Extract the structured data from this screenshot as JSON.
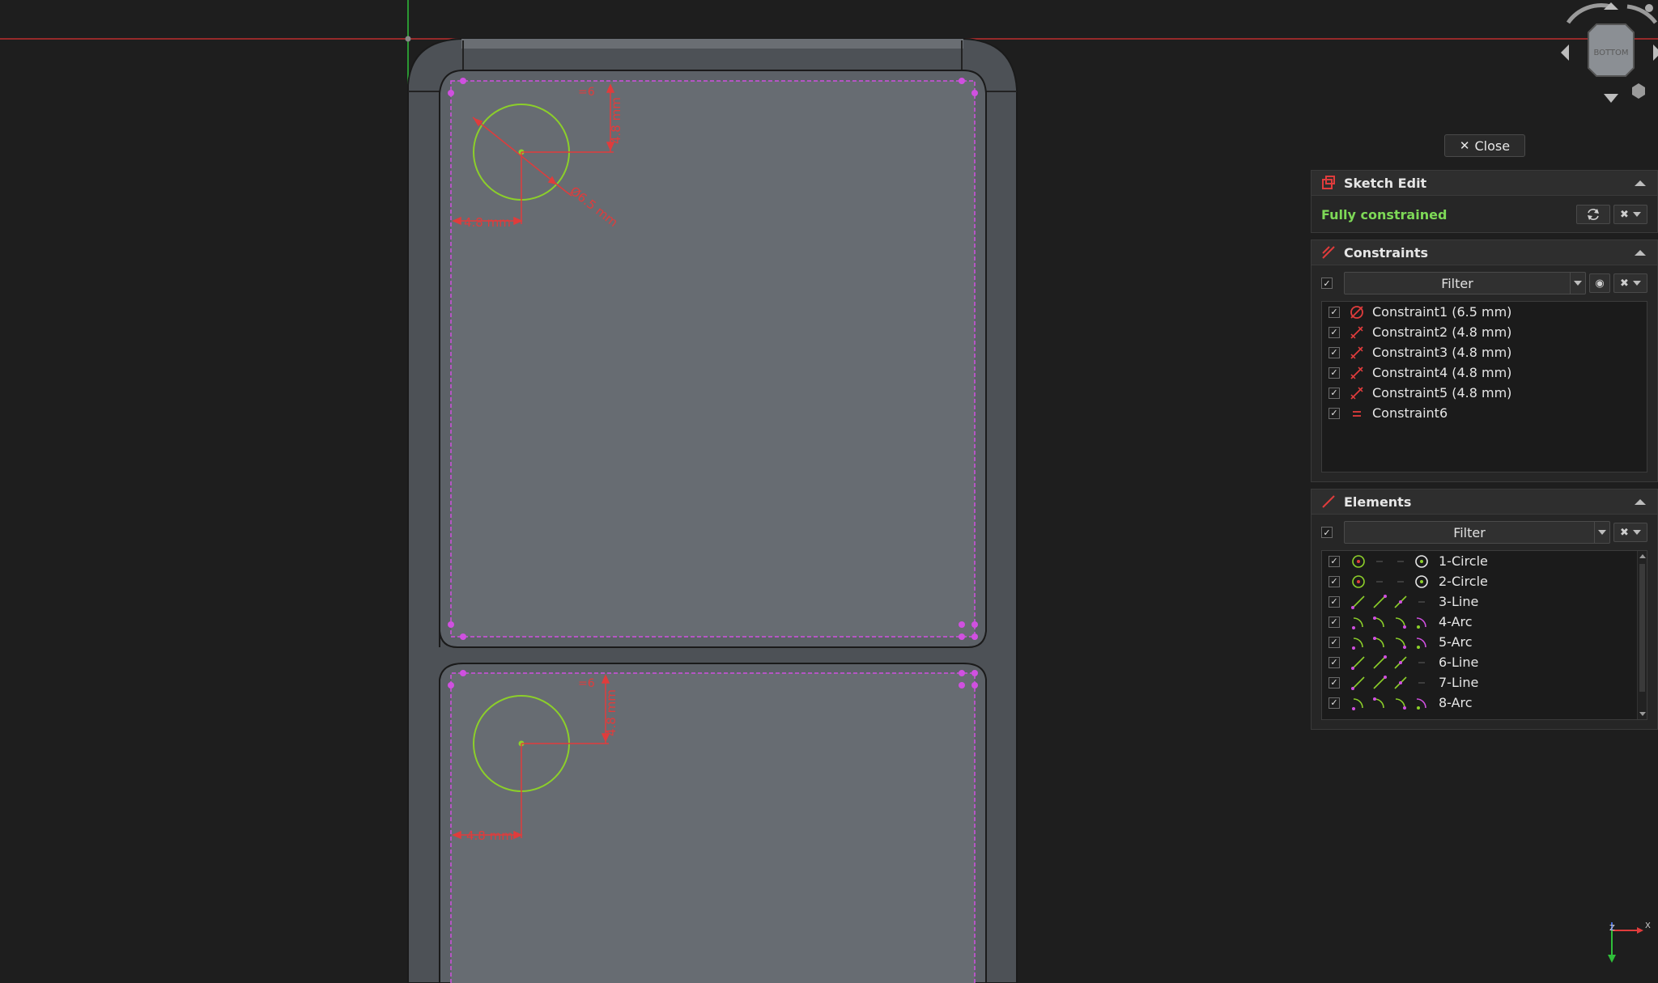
{
  "navcube": {
    "face_label": "BOTTOM"
  },
  "close_button": {
    "label": "Close"
  },
  "sketch_edit": {
    "title": "Sketch Edit",
    "status": "Fully constrained"
  },
  "constraints": {
    "title": "Constraints",
    "filter_label": "Filter",
    "items": [
      {
        "label": "Constraint1 (6.5 mm)",
        "kind": "diameter"
      },
      {
        "label": "Constraint2 (4.8 mm)",
        "kind": "distance"
      },
      {
        "label": "Constraint3 (4.8 mm)",
        "kind": "distance"
      },
      {
        "label": "Constraint4 (4.8 mm)",
        "kind": "distance"
      },
      {
        "label": "Constraint5 (4.8 mm)",
        "kind": "distance"
      },
      {
        "label": "Constraint6",
        "kind": "equal"
      }
    ]
  },
  "elements": {
    "title": "Elements",
    "filter_label": "Filter",
    "items": [
      {
        "label": "1-Circle",
        "kind": "circle"
      },
      {
        "label": "2-Circle",
        "kind": "circle"
      },
      {
        "label": "3-Line",
        "kind": "line"
      },
      {
        "label": "4-Arc",
        "kind": "arc"
      },
      {
        "label": "5-Arc",
        "kind": "arc"
      },
      {
        "label": "6-Line",
        "kind": "line"
      },
      {
        "label": "7-Line",
        "kind": "line"
      },
      {
        "label": "8-Arc",
        "kind": "arc"
      }
    ]
  },
  "dimensions": {
    "top_diameter": "Ø6.5 mm",
    "top_horizontal": "4.8 mm",
    "top_vertical": "4.8 mm",
    "top_equal_mark": "=6",
    "bottom_horizontal": "4.8 mm",
    "bottom_vertical": "4.8 mm",
    "bottom_equal_mark": "=6"
  },
  "axes_indicator": {
    "x": "X",
    "z": "Z"
  },
  "colors": {
    "background": "#1e1e1e",
    "face": "#656a70",
    "constraint": "#e03c3c",
    "geometry_green": "#8ccf2a",
    "vertex_magenta": "#d050e0",
    "status_green": "#7ed957"
  }
}
